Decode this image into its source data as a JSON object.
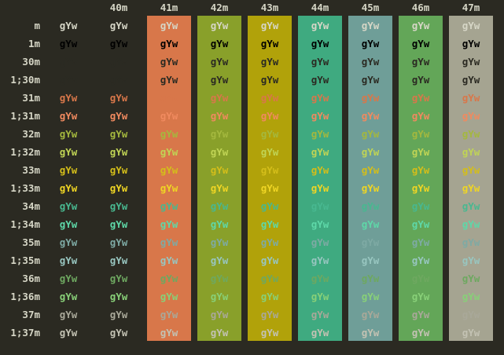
{
  "sample": "gYw",
  "rows": [
    "m",
    "1m",
    "30m",
    "1;30m",
    "31m",
    "1;31m",
    "32m",
    "1;32m",
    "33m",
    "1;33m",
    "34m",
    "1;34m",
    "35m",
    "1;35m",
    "36m",
    "1;36m",
    "37m",
    "1;37m"
  ],
  "bg_headers": [
    "40m",
    "41m",
    "42m",
    "43m",
    "44m",
    "45m",
    "46m",
    "47m"
  ],
  "bg_colors": [
    "#2b2a22",
    "#d8774a",
    "#89a02a",
    "#b1a20a",
    "#3faa80",
    "#6f9e98",
    "#63a658",
    "#a5a491"
  ],
  "fg_colors": {
    "m": "#d6d6c6",
    "1m": "#000000",
    "30m": "#2b2a22",
    "1;30m": "#2b2a22",
    "31m": "#d8774a",
    "1;31m": "#f08a5f",
    "32m": "#a4b83e",
    "1;32m": "#c0d455",
    "33m": "#d4be1a",
    "1;33m": "#efd524",
    "34m": "#48b890",
    "1;34m": "#5ed8a8",
    "35m": "#7eaaa4",
    "1;35m": "#98c6c0",
    "36m": "#6ea860",
    "1;36m": "#88d078",
    "37m": "#a9a899",
    "1;37m": "#c3c2b3"
  }
}
